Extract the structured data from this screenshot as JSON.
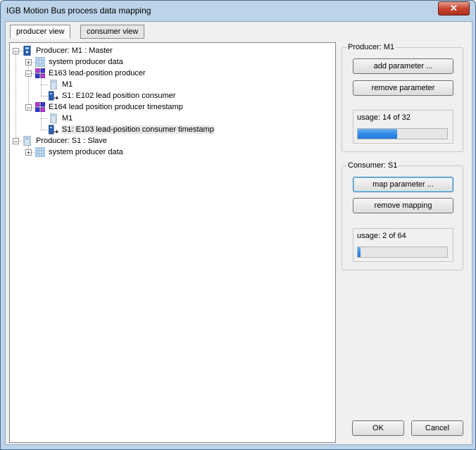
{
  "window": {
    "title": "IGB Motion Bus process data mapping",
    "close_label": "✕"
  },
  "tabs": [
    {
      "label": "producer view",
      "active": true
    },
    {
      "label": "consumer view",
      "active": false
    }
  ],
  "tree": {
    "nodes": [
      {
        "label": "Producer: M1 : Master",
        "icon": "master-device-icon"
      },
      {
        "label": "system producer data",
        "icon": "data-grid-icon"
      },
      {
        "label": "E163 lead-position producer",
        "icon": "parameter-producer-icon"
      },
      {
        "label": "M1",
        "icon": "device-icon"
      },
      {
        "label": "S1: E102 lead position consumer",
        "icon": "consumer-link-icon"
      },
      {
        "label": "E164 lead position producer timestamp",
        "icon": "parameter-producer-icon"
      },
      {
        "label": "M1",
        "icon": "device-icon"
      },
      {
        "label": "S1: E103 lead-position consumer timestamp",
        "icon": "consumer-link-icon"
      },
      {
        "label": "Producer: S1 : Slave",
        "icon": "slave-device-icon"
      },
      {
        "label": "system producer data",
        "icon": "data-grid-icon"
      }
    ]
  },
  "producer_panel": {
    "title": "Producer: M1",
    "add_label": "add parameter ...",
    "remove_label": "remove parameter",
    "usage_label": "usage: 14 of 32",
    "usage_fraction": 0.4375
  },
  "consumer_panel": {
    "title": "Consumer: S1",
    "map_label": "map parameter ...",
    "remove_label": "remove mapping",
    "usage_label": "usage: 2 of 64",
    "usage_fraction": 0.03125
  },
  "footer": {
    "ok_label": "OK",
    "cancel_label": "Cancel"
  },
  "colors": {
    "accent": "#2f8de4",
    "selection": "#e6e6e6"
  }
}
